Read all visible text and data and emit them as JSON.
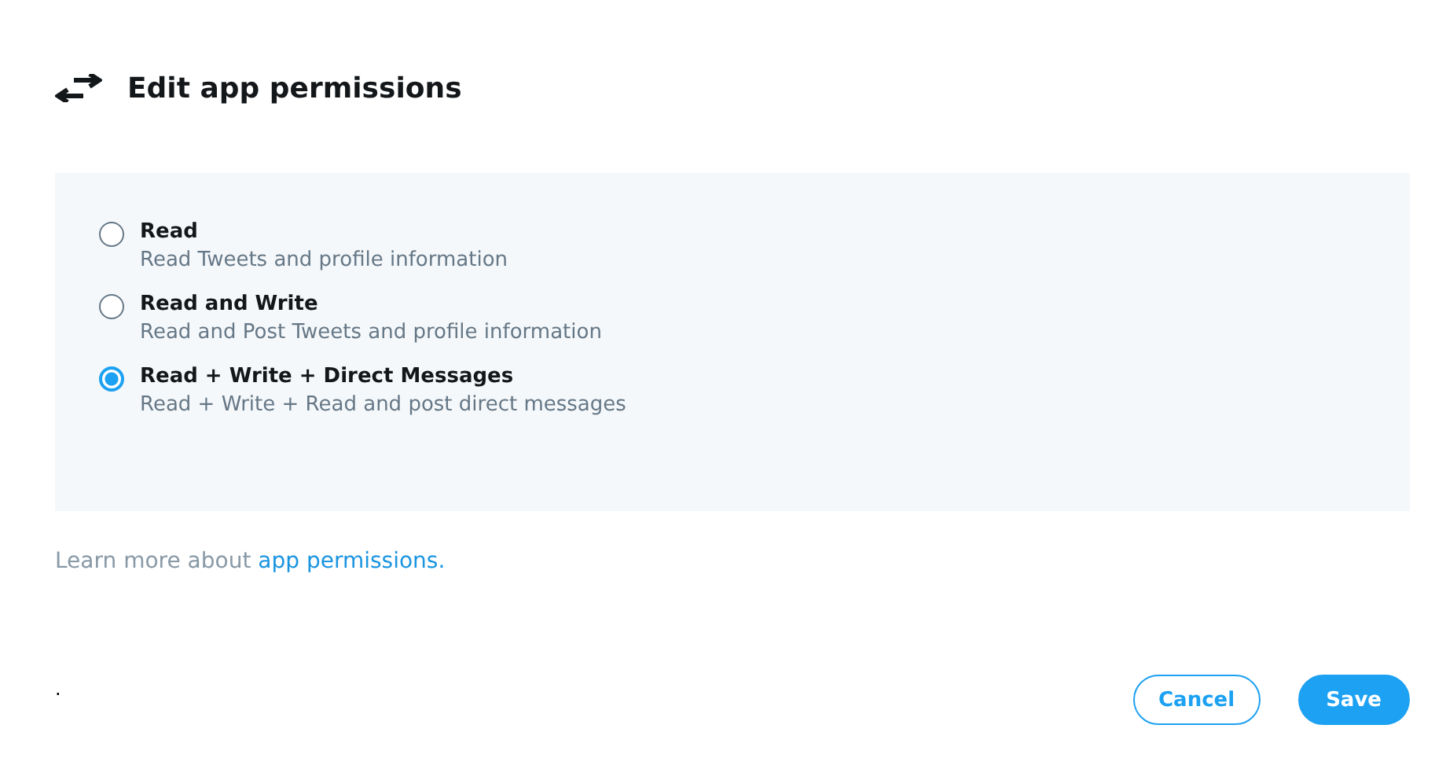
{
  "header": {
    "title": "Edit app permissions"
  },
  "options": [
    {
      "label": "Read",
      "description": "Read Tweets and profile information",
      "selected": false
    },
    {
      "label": "Read and Write",
      "description": "Read and Post Tweets and profile information",
      "selected": false
    },
    {
      "label": "Read + Write + Direct Messages",
      "description": "Read + Write + Read and post direct messages",
      "selected": true
    }
  ],
  "learn_more": {
    "text": "Learn more about ",
    "link": "app permissions",
    "suffix": "."
  },
  "footer": {
    "mark": ".",
    "buttons": [
      {
        "label": "Cancel",
        "kind": "outline"
      },
      {
        "label": "Save",
        "kind": "primary"
      }
    ]
  }
}
